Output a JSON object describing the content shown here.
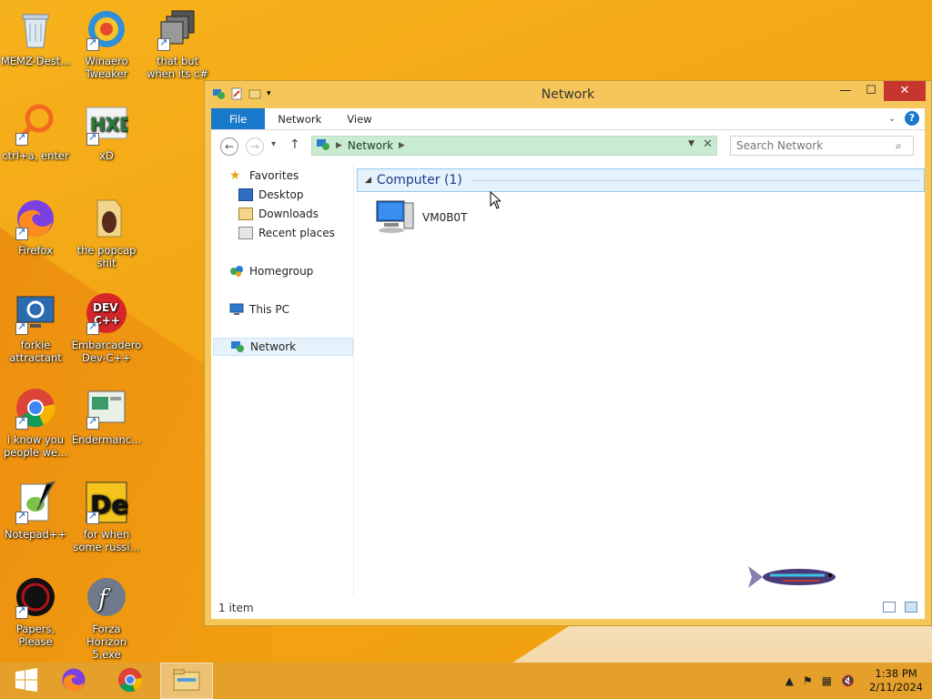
{
  "desktop": {
    "icons": [
      {
        "label": "MEMZ-Dest..."
      },
      {
        "label": "Winaero Tweaker"
      },
      {
        "label": "that but when its c#"
      },
      {
        "label": "ctrl+a, enter"
      },
      {
        "label": "xD"
      },
      {
        "label": "Firefox"
      },
      {
        "label": "the popcap shit"
      },
      {
        "label": "forkie attractant"
      },
      {
        "label": "Embarcadero Dev-C++"
      },
      {
        "label": "i know you people we..."
      },
      {
        "label": "Endermanc..."
      },
      {
        "label": "Notepad++"
      },
      {
        "label": "for when some russi..."
      },
      {
        "label": "Papers, Please"
      },
      {
        "label": "Forza Horizon 5.exe"
      }
    ]
  },
  "window": {
    "title": "Network",
    "controls": {
      "minimize": "—",
      "maximize": "☐",
      "close": "✕"
    },
    "ribbon": {
      "tabs": [
        {
          "label": "File"
        },
        {
          "label": "Network"
        },
        {
          "label": "View"
        }
      ],
      "expand_icon": "chevron-down-icon",
      "help_label": "?"
    },
    "navigation": {
      "back": "←",
      "forward": "→",
      "recent": "▾",
      "up": "↑",
      "address": {
        "crumbs": [
          "Network"
        ]
      },
      "search": {
        "placeholder": "Search Network"
      }
    },
    "nav_pane": {
      "favorites": "Favorites",
      "desktop": "Desktop",
      "downloads": "Downloads",
      "recent_places": "Recent places",
      "homegroup": "Homegroup",
      "this_pc": "This PC",
      "network": "Network"
    },
    "content": {
      "group_title": "Computer (1)",
      "items": [
        {
          "name": "VM0B0T"
        }
      ]
    },
    "status": {
      "count": "1 item"
    }
  },
  "taskbar": {
    "clock": {
      "time": "1:38 PM",
      "date": "2/11/2024"
    }
  },
  "colors": {
    "accent": "#1979ca",
    "desktop": "#f3a413",
    "window_frame": "#f5c75a",
    "address_bg": "#c9ecd1",
    "close": "#c7362e"
  }
}
